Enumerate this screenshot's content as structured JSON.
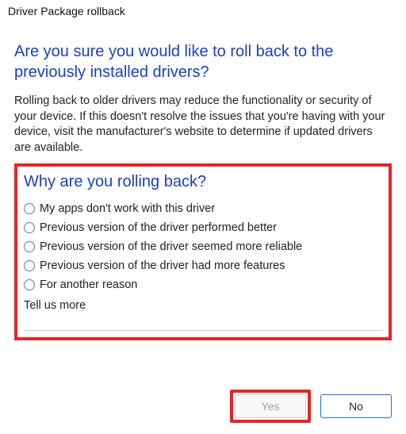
{
  "titlebar": "Driver Package rollback",
  "headline": "Are you sure you would like to roll back to the previously installed drivers?",
  "body": "Rolling back to older drivers may reduce the functionality or security of your device. If this doesn't resolve the issues that you're having with your device, visit the manufacturer's website to determine if updated drivers are available.",
  "subhead": "Why are you rolling back?",
  "options": [
    "My apps don't work with this driver",
    "Previous version of the driver performed better",
    "Previous version of the driver seemed more reliable",
    "Previous version of the driver had more features",
    "For another reason"
  ],
  "tell_us_label": "Tell us more",
  "tell_us_value": "",
  "buttons": {
    "yes": "Yes",
    "no": "No"
  }
}
